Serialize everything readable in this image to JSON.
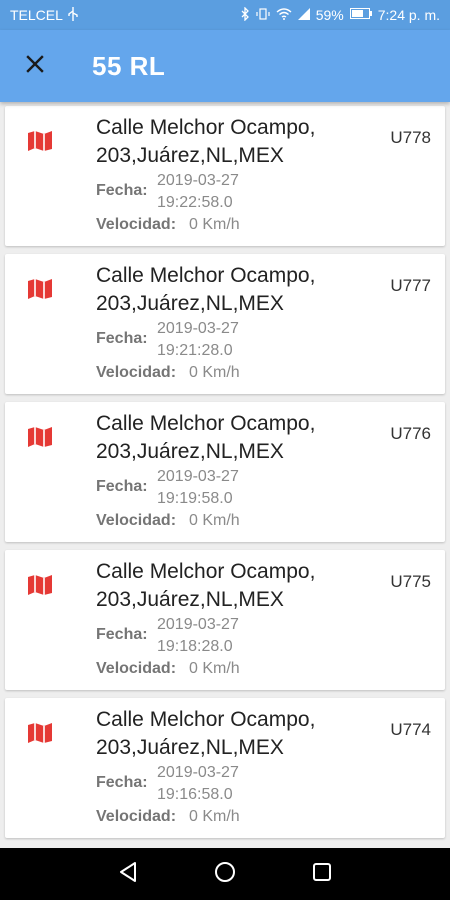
{
  "status_bar": {
    "carrier": "TELCEL",
    "battery": "59%",
    "time": "7:24 p. m."
  },
  "app_bar": {
    "title": "55 RL"
  },
  "labels": {
    "fecha": "Fecha:",
    "velocidad": "Velocidad:"
  },
  "colors": {
    "primary": "#64a6ec",
    "status_bar": "#5b9ee0",
    "map_icon": "#e53935"
  },
  "records": [
    {
      "address_line1": "Calle Melchor Ocampo,",
      "address_line2": "203,Juárez,NL,MEX",
      "unit": "U778",
      "date": "2019-03-27",
      "time": "19:22:58.0",
      "speed": "0 Km/h"
    },
    {
      "address_line1": "Calle Melchor Ocampo,",
      "address_line2": "203,Juárez,NL,MEX",
      "unit": "U777",
      "date": "2019-03-27",
      "time": "19:21:28.0",
      "speed": "0 Km/h"
    },
    {
      "address_line1": "Calle Melchor Ocampo,",
      "address_line2": "203,Juárez,NL,MEX",
      "unit": "U776",
      "date": "2019-03-27",
      "time": "19:19:58.0",
      "speed": "0 Km/h"
    },
    {
      "address_line1": "Calle Melchor Ocampo,",
      "address_line2": "203,Juárez,NL,MEX",
      "unit": "U775",
      "date": "2019-03-27",
      "time": "19:18:28.0",
      "speed": "0 Km/h"
    },
    {
      "address_line1": "Calle Melchor Ocampo,",
      "address_line2": "203,Juárez,NL,MEX",
      "unit": "U774",
      "date": "2019-03-27",
      "time": "19:16:58.0",
      "speed": "0 Km/h"
    }
  ]
}
